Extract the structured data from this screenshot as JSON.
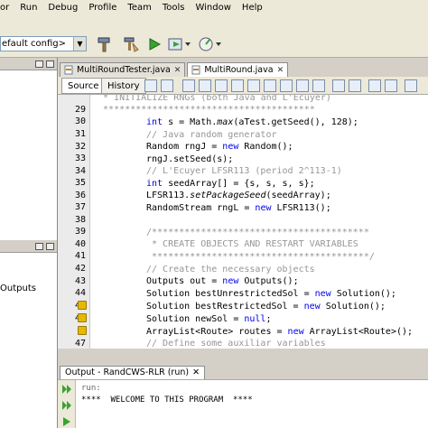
{
  "menu": [
    "or",
    "Run",
    "Debug",
    "Profile",
    "Team",
    "Tools",
    "Window",
    "Help"
  ],
  "toolbar": {
    "config_value": "efault config>"
  },
  "left_panel": {
    "outputs_label": "Outputs"
  },
  "tabs": [
    {
      "label": "MultiRoundTester.java",
      "active": false
    },
    {
      "label": "MultiRound.java",
      "active": true
    }
  ],
  "editor_toolbar": {
    "source_label": "Source",
    "history_label": "History"
  },
  "gutter": {
    "line_numbers": [
      "29",
      "30",
      "31",
      "32",
      "33",
      "34",
      "35",
      "36",
      "37",
      "38",
      "39",
      "40",
      "41",
      "42",
      "43",
      "44",
      "45",
      "46",
      "47"
    ]
  },
  "code": {
    "l0": "  * INITIALIZE RNGs (both Java and L'Ecuyer)",
    "l1": "  ***************************************",
    "l2_kw": "int",
    "l2_a": " s = Math.",
    "l2_it": "max",
    "l2_b": "(aTest.getSeed(), 128);",
    "l3": "// Java random generator",
    "l4_a": "Random rngJ = ",
    "l4_kw": "new",
    "l4_b": " Random();",
    "l5": "rngJ.setSeed(s);",
    "l6": "// L'Ecuyer LFSR113 (period 2^113-1)",
    "l7_kw": "int",
    "l7_a": " seedArray[] = {s, s, s, s};",
    "l8_a": "LFSR113.",
    "l8_it": "setPackageSeed",
    "l8_b": "(seedArray);",
    "l9_a": "RandomStream rngL = ",
    "l9_kw": "new",
    "l9_b": " LFSR113();",
    "l10": "",
    "l11": "/****************************************",
    "l12": " * CREATE OBJECTS AND RESTART VARIABLES",
    "l13": " ****************************************/",
    "l14": "// Create the necessary objects",
    "l15_a": "Outputs out = ",
    "l15_kw": "new",
    "l15_b": " Outputs();",
    "l16_a": "Solution bestUnrestrictedSol = ",
    "l16_kw": "new",
    "l16_b": " Solution();",
    "l17_a": "Solution bestRestrictedSol = ",
    "l17_kw": "new",
    "l17_b": " Solution();",
    "l18_a": "Solution newSol = ",
    "l18_kw": "null",
    "l18_b": ";",
    "l19_a": "ArrayList<Route> routes = ",
    "l19_kw": "new",
    "l19_b": " ArrayList<Route>();",
    "l20": "// Define some auxiliar variables"
  },
  "output": {
    "tab_label": "Output - RandCWS-RLR (run)",
    "line1": "run:",
    "line2": "****  WELCOME TO THIS PROGRAM  ****"
  },
  "colors": {
    "keyword": "#0000e6",
    "comment": "#969696",
    "warning_marker": "#e6b800"
  }
}
